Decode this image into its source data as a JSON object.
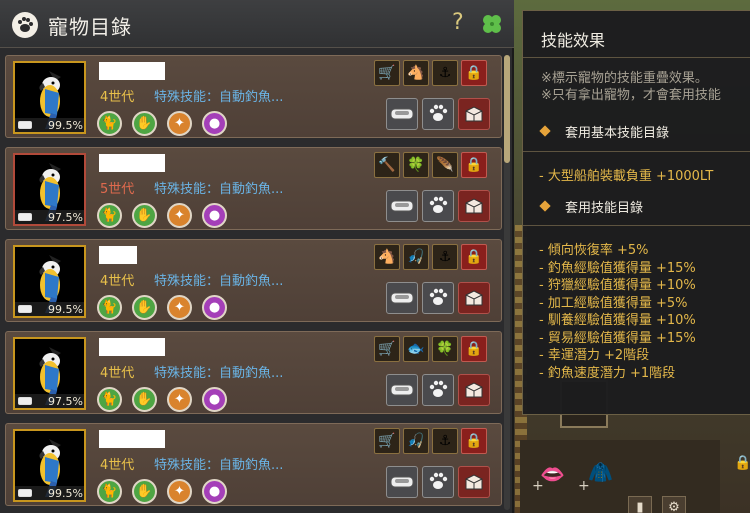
{
  "panel": {
    "title": "寵物目錄",
    "help_label": "?",
    "header_icons": [
      "paw-icon",
      "clover-icon"
    ]
  },
  "pets": [
    {
      "generation": "4世代",
      "skill_text": "特殊技能：自動釣魚...",
      "stat_value": "99.5%",
      "generation_color": "#e8c04a",
      "portrait_border": "gold",
      "skill_icons": [
        "carriage-icon",
        "horse-head-icon",
        "anchor-icon",
        "lock-icon"
      ]
    },
    {
      "generation": "5世代",
      "skill_text": "特殊技能：自動釣魚...",
      "stat_value": "97.5%",
      "generation_color": "#e06a4e",
      "portrait_border": "red",
      "skill_icons": [
        "hammer-icon",
        "clover-icon",
        "feather-icon",
        "lock-icon"
      ]
    },
    {
      "generation": "4世代",
      "skill_text": "特殊技能：自動釣魚...",
      "stat_value": "99.5%",
      "generation_color": "#e8c04a",
      "portrait_border": "gold",
      "skill_icons": [
        "horse-head-icon",
        "fishing-rod-icon",
        "anchor-icon",
        "lock-icon"
      ]
    },
    {
      "generation": "4世代",
      "skill_text": "特殊技能：自動釣魚...",
      "stat_value": "97.5%",
      "generation_color": "#e8c04a",
      "portrait_border": "gold",
      "skill_icons": [
        "carriage-icon",
        "fish-icon",
        "clover-icon",
        "lock-icon"
      ]
    },
    {
      "generation": "4世代",
      "skill_text": "特殊技能：自動釣魚...",
      "stat_value": "99.5%",
      "generation_color": "#e8c04a",
      "portrait_border": "gold",
      "skill_icons": [
        "carriage-icon",
        "fishing-rod-icon",
        "anchor-icon",
        "lock-icon"
      ]
    }
  ],
  "tooltip": {
    "title": "技能效果",
    "notes": [
      "※標示寵物的技能重疊效果。",
      "※只有拿出寵物，才會套用技能"
    ],
    "section_basic": "套用基本技能目錄",
    "basic_items": [
      "- 大型船舶裝載負重 +1000LT"
    ],
    "section_skills": "套用技能目錄",
    "skill_items": [
      "- 傾向恢復率 +5%",
      "- 釣魚經驗值獲得量 +15%",
      "- 狩獵經驗值獲得量 +10%",
      "- 加工經驗值獲得量 +5%",
      "- 馴養經驗值獲得量 +10%",
      "- 貿易經驗值獲得量 +15%",
      "- 幸運潛力 +2階段",
      "- 釣魚速度潛力 +1階段"
    ]
  },
  "colors": {
    "accent_gold": "#e4b84a",
    "skill_blue": "#6ab4e6",
    "tooltip_bg": "#1c1c1e"
  }
}
